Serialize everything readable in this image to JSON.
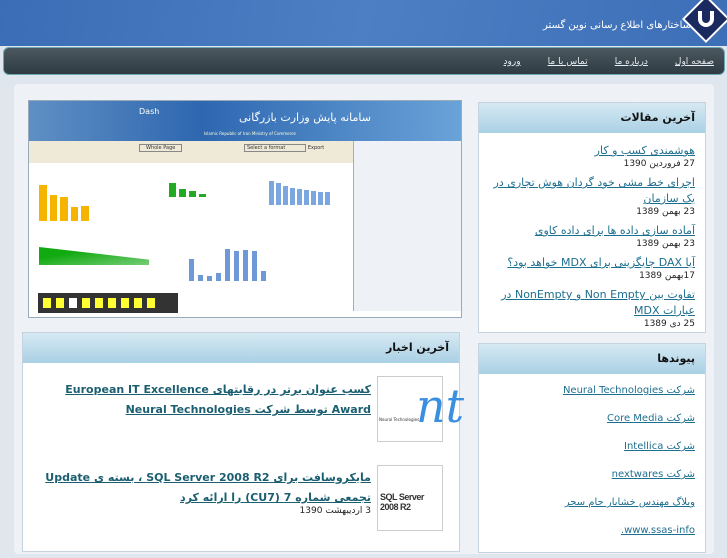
{
  "header": {
    "site_title": "ساختارهای اطلاع رسانی نوین گستر"
  },
  "nav": [
    "صفحه اول",
    "درباره ما",
    "تماس با ما",
    "ورود"
  ],
  "articles": {
    "title": "آخرین مقالات",
    "items": [
      {
        "title": "هوشمندی کسب و کار",
        "date": "27 فروردین 1390"
      },
      {
        "title": "اجرای خط مشی خود گردان هوش تجاری در یک سازمان",
        "date": "23 بهمن 1389"
      },
      {
        "title": "آماده سازی داده ها برای داده کاوی",
        "date": "23 بهمن 1389"
      },
      {
        "title": "آیا DAX جایگزینی برای MDX خواهد بود؟",
        "date": "17بهمن 1389"
      },
      {
        "title": "تفاوت بین Non Empty و NonEmpty در عبارات MDX",
        "date": "25 دی 1389"
      }
    ]
  },
  "links": {
    "title": "پیوندها",
    "items": [
      "شرکت Neural Technologies",
      "شرکت Core Media",
      "شرکت Intellica",
      "شرکت nextwares",
      "وبلاگ مهندس خشایار جام سحر",
      "www.ssas-info."
    ]
  },
  "news": {
    "title": "آخرین اخبار",
    "items": [
      {
        "title": "کسب عنوان برتر در رقابتهای European IT Excellence Award توسط شرکت Neural Technologies",
        "date": "",
        "thumb": "Neural Technologies"
      },
      {
        "title": "مایکروسافت برای SQL Server 2008 R2 ، بسته ی Update تجمعی شماره 7 (CU7) را ارائه کرد",
        "date": "3 اردیبهشت 1390",
        "thumb": "SQL Server 2008 R2"
      }
    ]
  },
  "dashboard": {
    "brand": "Dash",
    "heading": "سامانه پایش وزارت بازرگانی",
    "subheading": "Islamic Republic of Iran Ministry of Commerce",
    "format_select": "Select a format",
    "page_select": "Whole Page",
    "export": "Export"
  }
}
